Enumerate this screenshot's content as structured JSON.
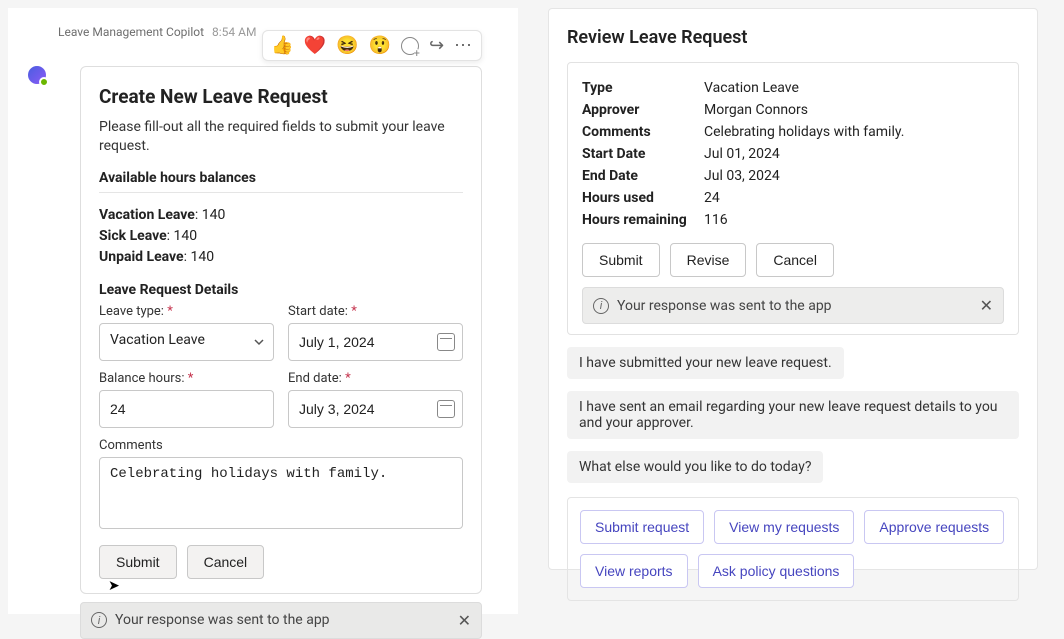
{
  "header": {
    "app_name": "Leave Management Copilot",
    "time": "8:54 AM",
    "reactions": {
      "thumb": "👍",
      "heart": "❤️",
      "laugh": "😆",
      "surprised": "😲"
    }
  },
  "create": {
    "title": "Create New Leave Request",
    "description": "Please fill-out all the required fields to submit your leave request.",
    "balances_heading": "Available hours balances",
    "balances": {
      "vacation_label": "Vacation Leave",
      "vacation_value": "140",
      "sick_label": "Sick Leave",
      "sick_value": "140",
      "unpaid_label": "Unpaid Leave",
      "unpaid_value": "140"
    },
    "details_heading": "Leave Request Details",
    "labels": {
      "leave_type": "Leave type:",
      "start_date": "Start date:",
      "balance_hours": "Balance hours:",
      "end_date": "End date:",
      "comments": "Comments",
      "required_mark": "*"
    },
    "values": {
      "leave_type": "Vacation Leave",
      "start_date": "July 1, 2024",
      "balance_hours": "24",
      "end_date": "July 3, 2024",
      "comments": "Celebrating holidays with family."
    },
    "buttons": {
      "submit": "Submit",
      "cancel": "Cancel"
    },
    "status": "Your response was sent to the app"
  },
  "review": {
    "title": "Review Leave Request",
    "rows": {
      "type_k": "Type",
      "type_v": "Vacation Leave",
      "approver_k": "Approver",
      "approver_v": "Morgan Connors",
      "comments_k": "Comments",
      "comments_v": "Celebrating holidays with family.",
      "start_k": "Start Date",
      "start_v": "Jul 01, 2024",
      "end_k": "End Date",
      "end_v": "Jul 03, 2024",
      "used_k": "Hours used",
      "used_v": "24",
      "remain_k": "Hours remaining",
      "remain_v": "116"
    },
    "buttons": {
      "submit": "Submit",
      "revise": "Revise",
      "cancel": "Cancel"
    },
    "status": "Your response was sent to the app",
    "messages": {
      "m1": "I have submitted your new leave request.",
      "m2": "I have sent an email regarding your new leave request details to you and your approver.",
      "m3": "What else would you like to do today?"
    },
    "quick": {
      "q1": "Submit request",
      "q2": "View my requests",
      "q3": "Approve requests",
      "q4": "View reports",
      "q5": "Ask policy questions"
    }
  }
}
